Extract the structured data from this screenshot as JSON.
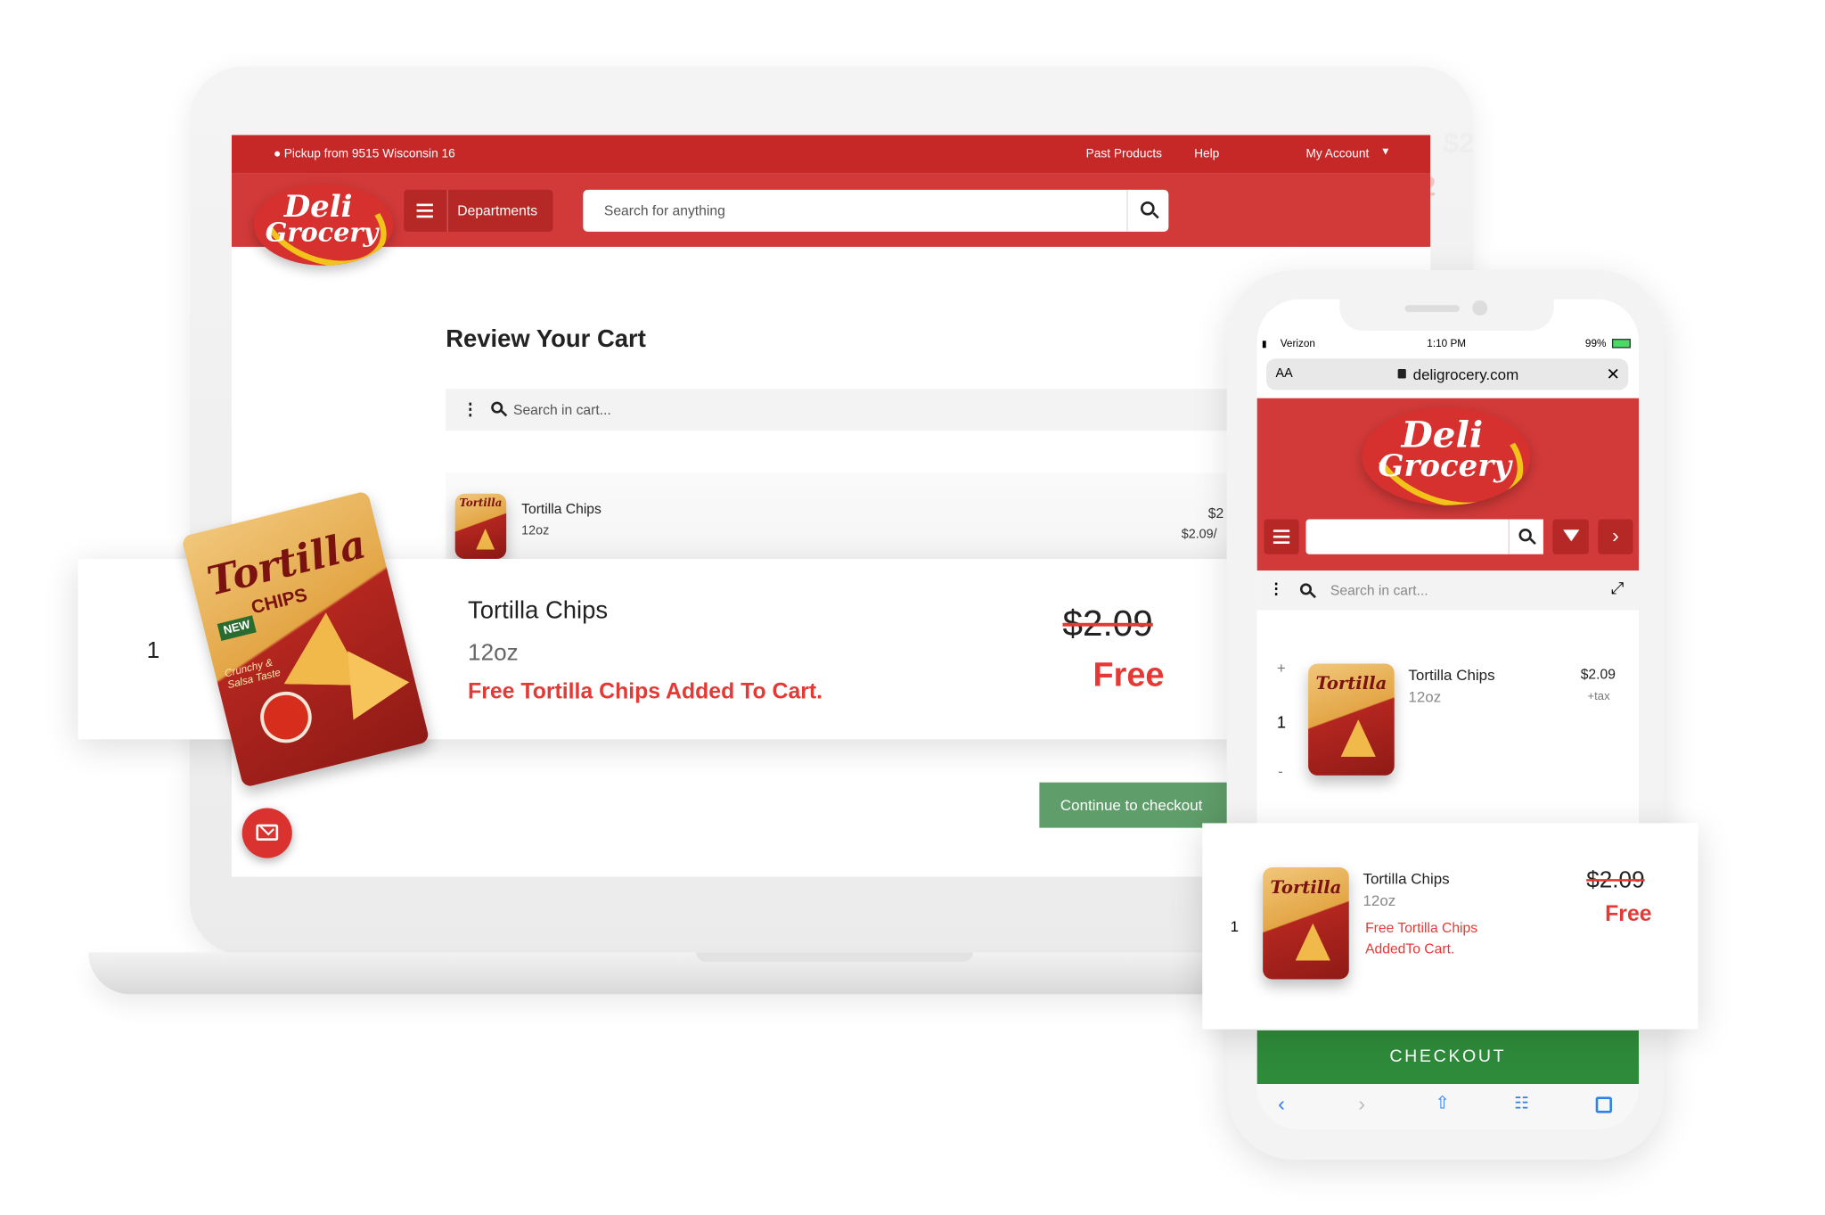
{
  "brand": {
    "logo_line1": "Deli",
    "logo_line2": "Grocery"
  },
  "desktop": {
    "pickup_text": "Pickup from 9515 Wisconsin 16",
    "nav_past_products": "Past Products",
    "nav_help": "Help",
    "nav_account": "My Account",
    "departments_label": "Departments",
    "search_placeholder": "Search for anything",
    "page_title": "Review Your Cart",
    "cart_search_placeholder": "Search in cart...",
    "cart_item": {
      "name": "Tortilla Chips",
      "size": "12oz",
      "price_partial": "$2",
      "unit_price_partial": "$2.09/"
    },
    "checkout_button": "Continue to checkout",
    "ghost_prices": [
      "$2",
      "$2"
    ]
  },
  "desktop_overlay": {
    "quantity": "1",
    "name": "Tortilla Chips",
    "size": "12oz",
    "promo": "Free Tortilla Chips Added To Cart.",
    "old_price": "$2.09",
    "new_price": "Free"
  },
  "product_bag": {
    "brand": "Tortilla",
    "sub": "CHIPS",
    "badge": "NEW",
    "flavor": "Crunchy & Salsa Taste"
  },
  "mobile": {
    "carrier": "Verizon",
    "time": "1:10 PM",
    "battery": "99%",
    "text_size": "AA",
    "url": "deligrocery.com",
    "close_glyph": "✕",
    "cart_search_placeholder": "Search in cart...",
    "qty_plus": "+",
    "qty_minus": "-",
    "cart_item": {
      "quantity": "1",
      "name": "Tortilla Chips",
      "size": "12oz",
      "price": "$2.09",
      "tax_note": "+tax"
    },
    "checkout_button": "CHECKOUT"
  },
  "mobile_overlay": {
    "quantity": "1",
    "name": "Tortilla Chips",
    "size": "12oz",
    "promo_line1": "Free Tortilla Chips",
    "promo_line2": "AddedTo Cart.",
    "old_price": "$2.09",
    "new_price": "Free"
  },
  "colors": {
    "brand_red": "#d23a39",
    "dark_red": "#c62828",
    "promo_red": "#e53935",
    "checkout_green": "#2e8b3a",
    "desktop_checkout_green": "#5f9e6a",
    "logo_yellow": "#f2c318"
  }
}
